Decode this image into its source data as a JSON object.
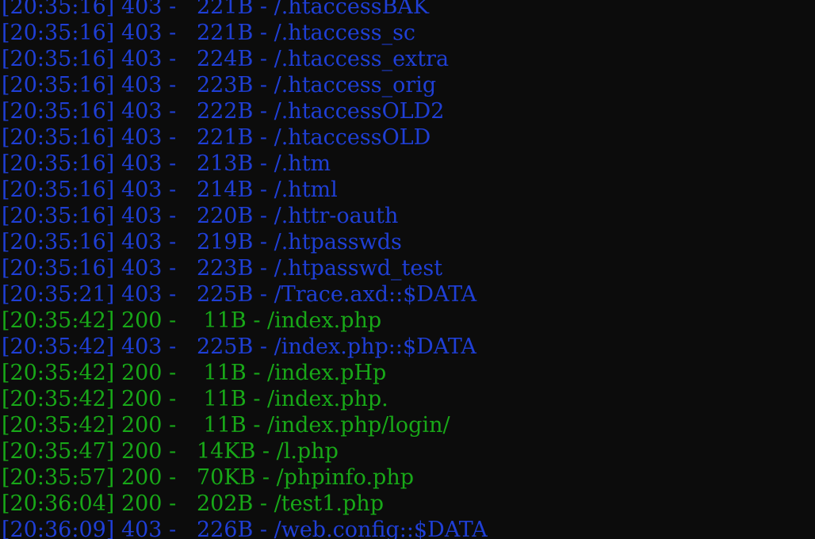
{
  "terminal": {
    "colors": {
      "background": "#0c0c0c",
      "status_403": "#1f3fd6",
      "status_200": "#18a818"
    },
    "lines": [
      {
        "time": "[20:35:16]",
        "status": "403",
        "size": "221B",
        "path": "/.htaccessBAK"
      },
      {
        "time": "[20:35:16]",
        "status": "403",
        "size": "221B",
        "path": "/.htaccess_sc"
      },
      {
        "time": "[20:35:16]",
        "status": "403",
        "size": "224B",
        "path": "/.htaccess_extra"
      },
      {
        "time": "[20:35:16]",
        "status": "403",
        "size": "223B",
        "path": "/.htaccess_orig"
      },
      {
        "time": "[20:35:16]",
        "status": "403",
        "size": "222B",
        "path": "/.htaccessOLD2"
      },
      {
        "time": "[20:35:16]",
        "status": "403",
        "size": "221B",
        "path": "/.htaccessOLD"
      },
      {
        "time": "[20:35:16]",
        "status": "403",
        "size": "213B",
        "path": "/.htm"
      },
      {
        "time": "[20:35:16]",
        "status": "403",
        "size": "214B",
        "path": "/.html"
      },
      {
        "time": "[20:35:16]",
        "status": "403",
        "size": "220B",
        "path": "/.httr-oauth"
      },
      {
        "time": "[20:35:16]",
        "status": "403",
        "size": "219B",
        "path": "/.htpasswds"
      },
      {
        "time": "[20:35:16]",
        "status": "403",
        "size": "223B",
        "path": "/.htpasswd_test"
      },
      {
        "time": "[20:35:21]",
        "status": "403",
        "size": "225B",
        "path": "/Trace.axd::$DATA"
      },
      {
        "time": "[20:35:42]",
        "status": "200",
        "size": "11B",
        "path": "/index.php"
      },
      {
        "time": "[20:35:42]",
        "status": "403",
        "size": "225B",
        "path": "/index.php::$DATA"
      },
      {
        "time": "[20:35:42]",
        "status": "200",
        "size": "11B",
        "path": "/index.pHp"
      },
      {
        "time": "[20:35:42]",
        "status": "200",
        "size": "11B",
        "path": "/index.php."
      },
      {
        "time": "[20:35:42]",
        "status": "200",
        "size": "11B",
        "path": "/index.php/login/"
      },
      {
        "time": "[20:35:47]",
        "status": "200",
        "size": "14KB",
        "path": "/l.php"
      },
      {
        "time": "[20:35:57]",
        "status": "200",
        "size": "70KB",
        "path": "/phpinfo.php"
      },
      {
        "time": "[20:36:04]",
        "status": "200",
        "size": "202B",
        "path": "/test1.php"
      },
      {
        "time": "[20:36:09]",
        "status": "403",
        "size": "226B",
        "path": "/web.config::$DATA"
      }
    ]
  }
}
